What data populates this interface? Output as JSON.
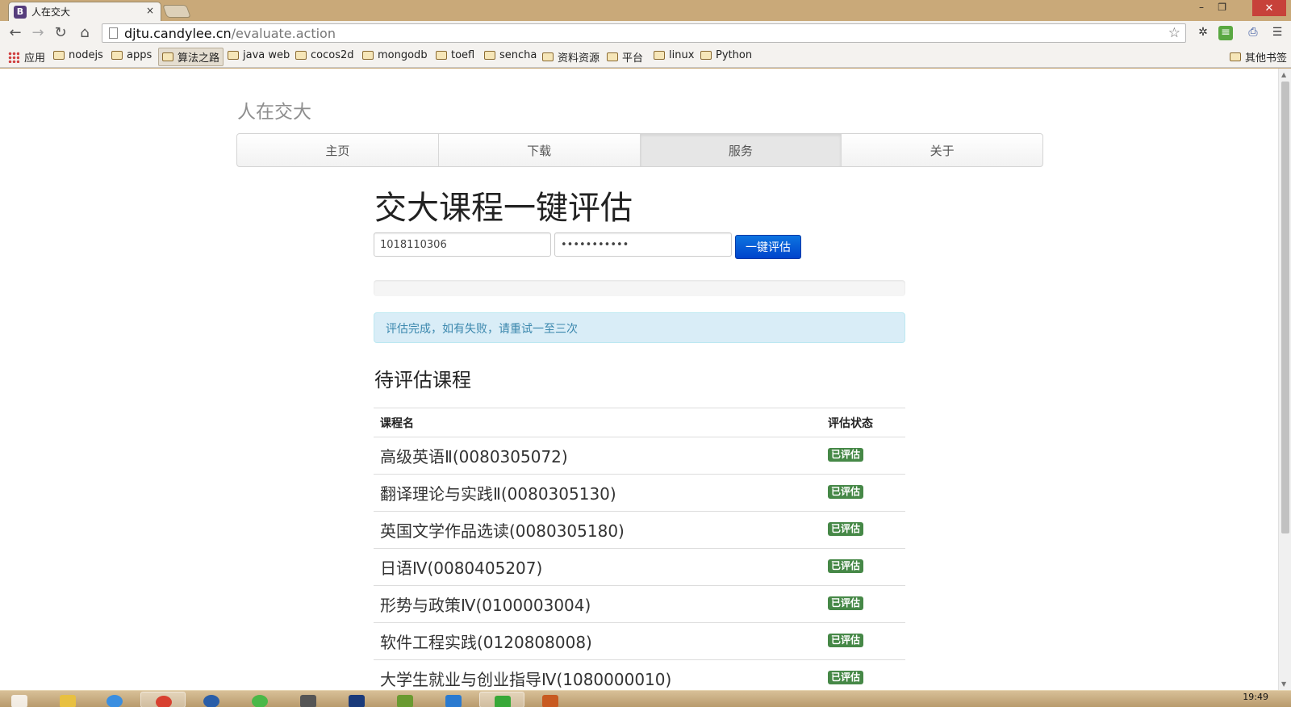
{
  "browser": {
    "tab_title": "人在交大",
    "favicon_letter": "B",
    "tab_close": "×",
    "url_host": "djtu.candylee.cn",
    "url_path": "/evaluate.action",
    "win_min": "–",
    "win_restore": "❐",
    "win_close": "✕",
    "nav_back": "←",
    "nav_forward": "→",
    "nav_reload": "↻",
    "nav_home": "⌂",
    "star": "☆",
    "menu": "☰"
  },
  "bookmarks": {
    "apps": "应用",
    "items": [
      "nodejs",
      "apps",
      "算法之路",
      "java web",
      "cocos2d",
      "mongodb",
      "toefl",
      "sencha",
      "资料资源",
      "平台",
      "linux",
      "Python"
    ],
    "other": "其他书签"
  },
  "site": {
    "brand": "人在交大",
    "nav": [
      "主页",
      "下载",
      "服务",
      "关于"
    ],
    "active_nav": "服务"
  },
  "page": {
    "title": "交大课程一键评估",
    "username_value": "1018110306",
    "password_value": "•••••••••••",
    "submit_label": "一键评估",
    "progress_percent": 0,
    "alert_text": "评估完成，如有失败，请重试一至三次",
    "list_title": "待评估课程"
  },
  "table": {
    "headers": [
      "课程名",
      "评估状态"
    ],
    "rows": [
      {
        "name": "高级英语Ⅱ(0080305072)",
        "status": "已评估"
      },
      {
        "name": "翻译理论与实践Ⅱ(0080305130)",
        "status": "已评估"
      },
      {
        "name": "英国文学作品选读(0080305180)",
        "status": "已评估"
      },
      {
        "name": "日语Ⅳ(0080405207)",
        "status": "已评估"
      },
      {
        "name": "形势与政策Ⅳ(0100003004)",
        "status": "已评估"
      },
      {
        "name": "软件工程实践(0120808008)",
        "status": "已评估"
      },
      {
        "name": "大学生就业与创业指导Ⅳ(1080000010)",
        "status": "已评估"
      }
    ]
  },
  "taskbar": {
    "clock": "19:49"
  },
  "colors": {
    "primary": "#0044cc",
    "success": "#468847",
    "alert_bg": "#d9edf7",
    "alert_text": "#3a87ad"
  }
}
